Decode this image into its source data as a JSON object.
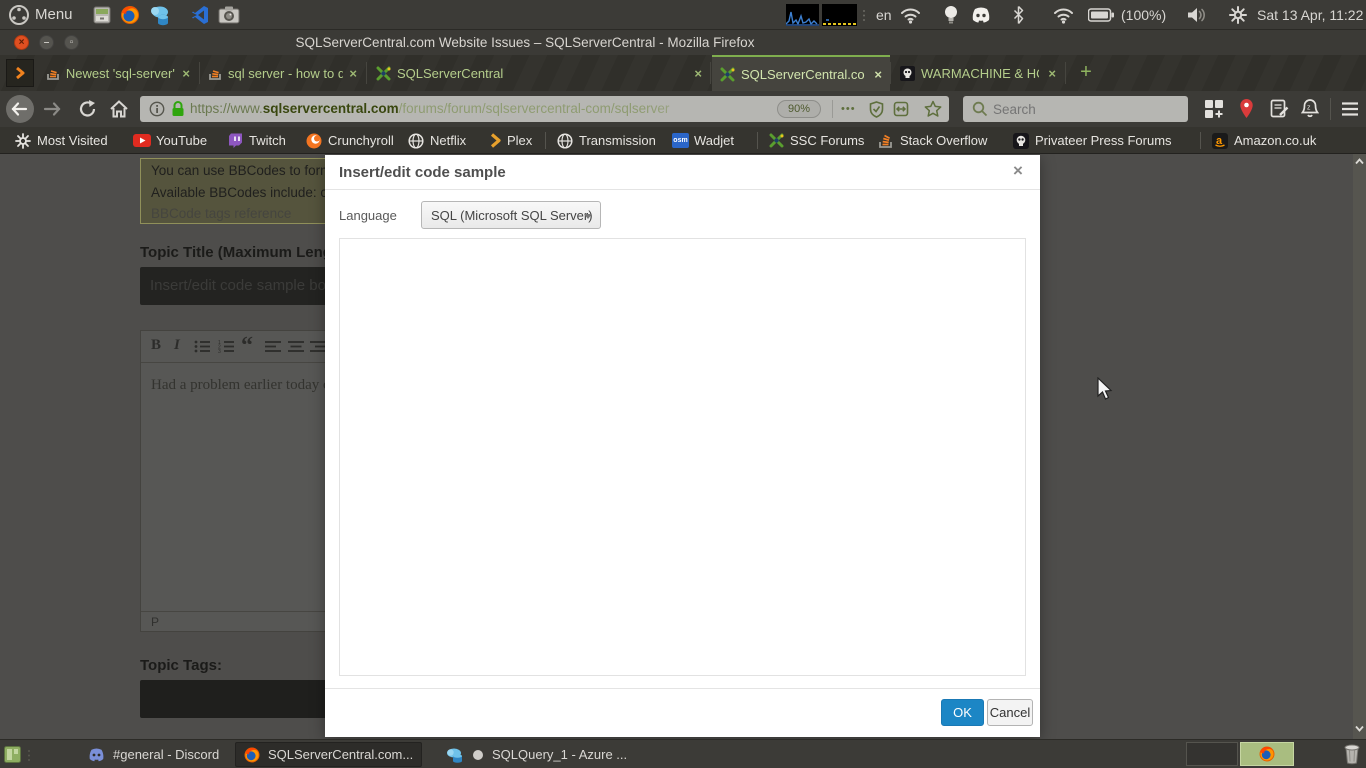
{
  "system_bar": {
    "menu_label": "Menu",
    "keyboard_indicator": "en",
    "battery_percent": "(100%)",
    "clock": "Sat 13 Apr, 11:22"
  },
  "window_title": "SQLServerCentral.com Website Issues – SQLServerCentral - Mozilla Firefox",
  "tab_bar": {
    "close_glyph": "×",
    "new_tab_glyph": "+",
    "tabs": [
      {
        "label": "Newest 'sql-server' Ques"
      },
      {
        "label": "sql server - how to declar"
      },
      {
        "label": "SQLServerCentral"
      },
      {
        "label": "SQLServerCentral.com W"
      },
      {
        "label": "WARMACHINE & HORDE"
      }
    ]
  },
  "nav_bar": {
    "url_scheme": "https://www.",
    "url_domain": "sqlservercentral.com",
    "url_path": "/forums/forum/sqlservercentral-com/sqlserver",
    "zoom_level": "90%",
    "page_actions_glyph": "•••",
    "search_placeholder": "Search"
  },
  "bookmarks_bar": {
    "items": [
      "Most Visited",
      "YouTube",
      "Twitch",
      "Crunchyroll",
      "Netflix",
      "Plex",
      "Transmission",
      "Wadjet",
      "SSC Forums",
      "Stack Overflow",
      "Privateer Press Forums",
      "Amazon.co.uk"
    ],
    "wadjet_icon_text": "osm"
  },
  "page": {
    "bbcode_line1": "You can use BBCodes to format yo",
    "bbcode_line2": "Available BBCodes include: code, b,",
    "bbcode_link": "BBCode tags reference",
    "topic_title_label": "Topic Title (Maximum Lengt",
    "topic_title_value": "Insert/edit code sample bo",
    "toolbar": {
      "bold": "B",
      "italic": "I",
      "quote": "“"
    },
    "editor_text": "Had a problem earlier today on",
    "editor_path": "P",
    "topic_tags_label": "Topic Tags:"
  },
  "dialog": {
    "title": "Insert/edit code sample",
    "close": "×",
    "language_label": "Language",
    "language_value": "SQL (Microsoft SQL Server)",
    "ok_label": "OK",
    "cancel_label": "Cancel"
  },
  "taskbar": {
    "items": [
      "#general - Discord",
      "SQLServerCentral.com...",
      "SQLQuery_1 - Azure ..."
    ]
  }
}
